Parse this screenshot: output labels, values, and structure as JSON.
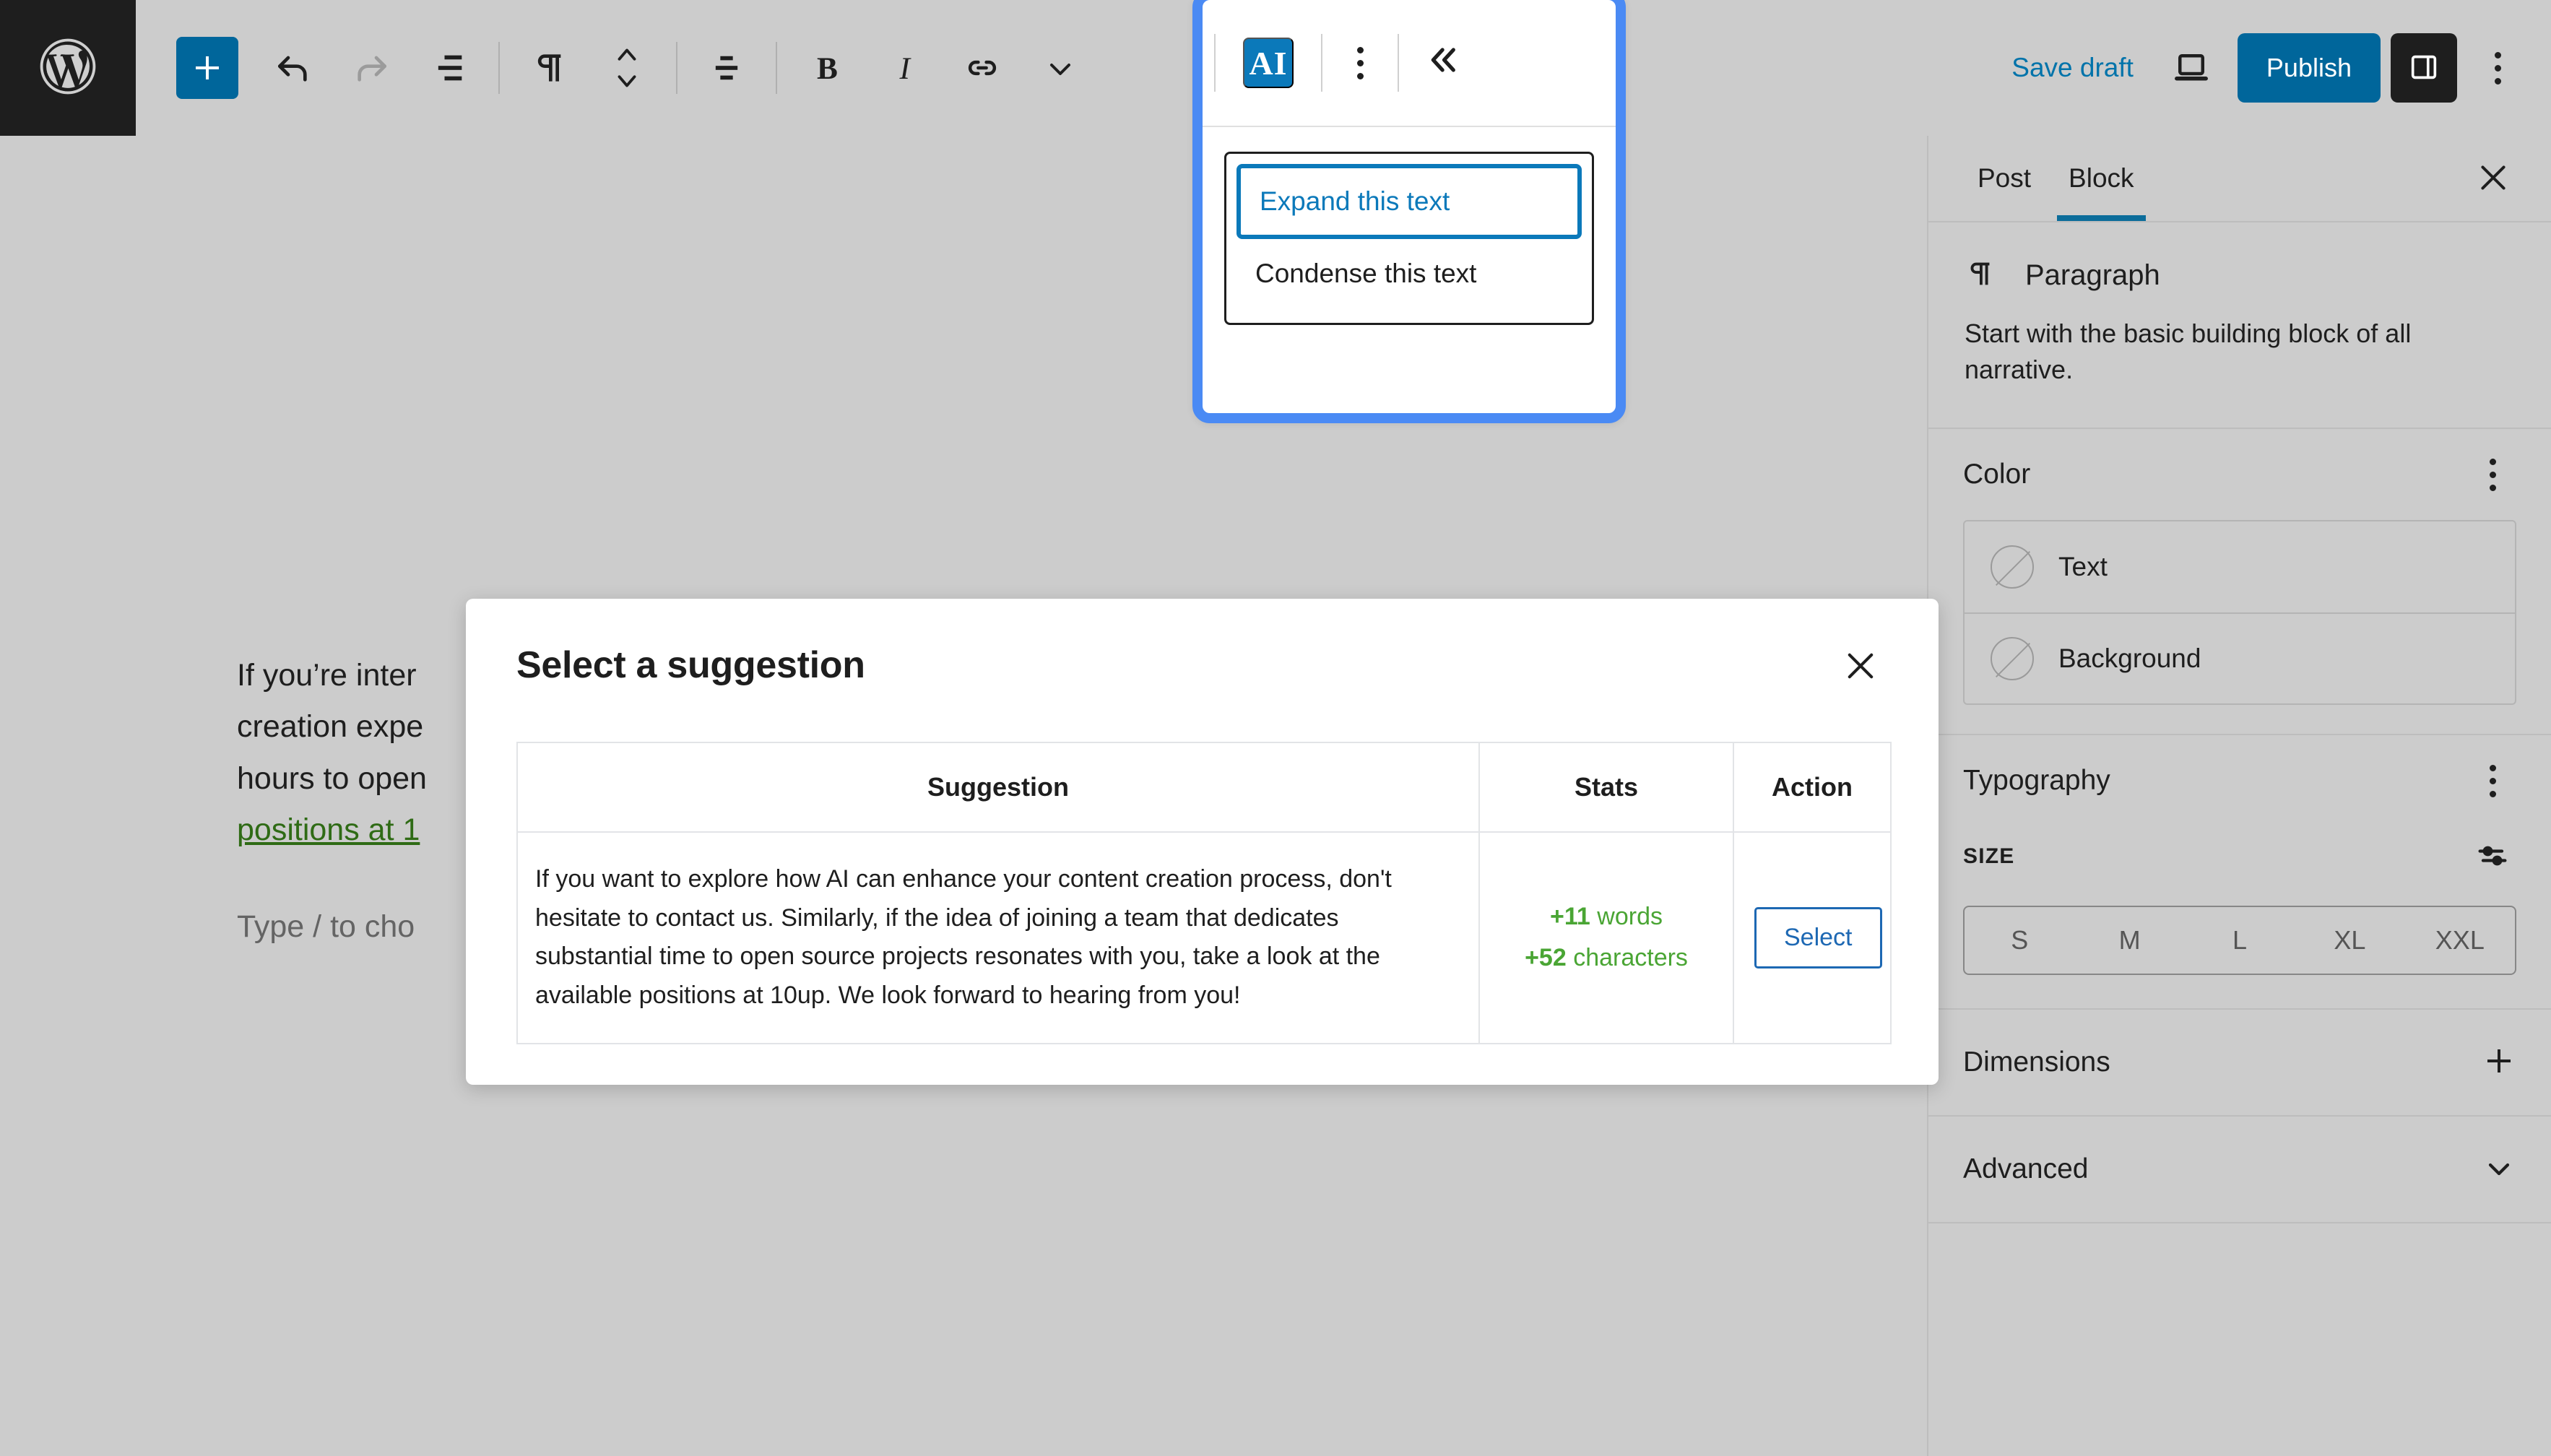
{
  "topbar": {
    "logo_icon": "wordpress-logo-icon",
    "tools": [
      {
        "icon": "plus-icon",
        "name": "add-block-button"
      },
      {
        "icon": "undo-arrow-icon",
        "name": "undo-button"
      },
      {
        "icon": "redo-arrow-icon",
        "name": "redo-button"
      },
      {
        "icon": "list-view-icon",
        "name": "document-overview-button"
      },
      {
        "icon": "paragraph-pilcrow-icon",
        "name": "block-type-button"
      },
      {
        "icon": "chevron-up-down-icon",
        "name": "move-block-button"
      },
      {
        "icon": "align-left-icon",
        "name": "align-button"
      },
      {
        "icon": "bold-b-icon",
        "name": "bold-button"
      },
      {
        "icon": "italic-i-icon",
        "name": "italic-button"
      },
      {
        "icon": "link-icon",
        "name": "link-button"
      },
      {
        "icon": "chevron-down-icon",
        "name": "more-rich-text-button"
      }
    ],
    "save_draft_label": "Save draft",
    "preview_icon": "preview-desktop-icon",
    "publish_label": "Publish",
    "sidebar_toggle_icon": "sidebar-panel-icon",
    "options_icon": "vertical-dots-icon"
  },
  "ai_popover": {
    "badge_label": "AI",
    "kebab_icon": "vertical-dots-icon",
    "collapse_icon": "double-chevron-left-icon",
    "options": [
      {
        "label": "Expand this text",
        "selected": true
      },
      {
        "label": "Condense this text",
        "selected": false
      }
    ]
  },
  "editor": {
    "paragraph_lead": "If you’re inter",
    "paragraph_line2": "creation expe",
    "paragraph_line3": "hours to open",
    "link_text": "positions at 1",
    "placeholder": "Type / to cho"
  },
  "modal": {
    "title": "Select a suggestion",
    "close_icon": "close-x-icon",
    "columns": [
      "Suggestion",
      "Stats",
      "Action"
    ],
    "rows": [
      {
        "suggestion": "If you want to explore how AI can enhance your content creation process, don't hesitate to contact us. Similarly, if the idea of joining a team that dedicates substantial time to open source projects resonates with you, take a look at the available positions at 10up. We look forward to hearing from you!",
        "stats_words_value": "+11",
        "stats_words_unit": "words",
        "stats_chars_value": "+52",
        "stats_chars_unit": "characters",
        "action_label": "Select"
      }
    ]
  },
  "sidebar": {
    "tabs": [
      {
        "label": "Post",
        "active": false
      },
      {
        "label": "Block",
        "active": true
      }
    ],
    "close_icon": "close-x-icon",
    "block": {
      "icon": "paragraph-pilcrow-icon",
      "name": "Paragraph",
      "description": "Start with the basic building block of all narrative."
    },
    "color": {
      "title": "Color",
      "options_icon": "vertical-dots-icon",
      "items": [
        {
          "label": "Text",
          "swatch_icon": "no-color-circle-icon"
        },
        {
          "label": "Background",
          "swatch_icon": "no-color-circle-icon"
        }
      ]
    },
    "typography": {
      "title": "Typography",
      "options_icon": "vertical-dots-icon",
      "size_label": "SIZE",
      "size_settings_icon": "sliders-icon",
      "sizes": [
        "S",
        "M",
        "L",
        "XL",
        "XXL"
      ]
    },
    "dimensions": {
      "title": "Dimensions",
      "toggle_icon": "plus-icon"
    },
    "advanced": {
      "title": "Advanced",
      "toggle_icon": "chevron-down-icon"
    }
  },
  "colors": {
    "wp_admin_dark": "#1e1e1e",
    "accent_blue": "#00669b",
    "ai_border_blue": "#4a8af4",
    "ai_badge_blue": "#0b79ba",
    "stats_green": "#4aa534",
    "link_green": "#2f6b15",
    "select_blue": "#1d68b3",
    "canvas_gray": "#cccccc"
  }
}
